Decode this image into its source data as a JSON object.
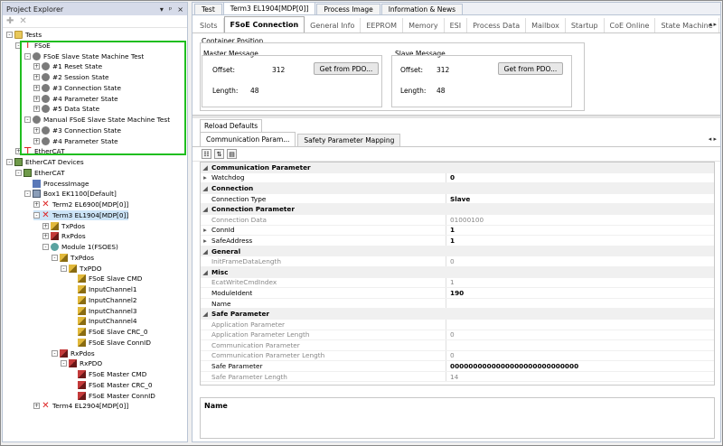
{
  "left": {
    "title": "Project Explorer",
    "title_btns": [
      "▾",
      "ᵖ",
      "×"
    ],
    "toolbar": [
      "✚",
      "✕"
    ]
  },
  "tree": [
    {
      "t": "Tests",
      "d": 0,
      "ic": "folder",
      "ex": "-"
    },
    {
      "t": "FSoE",
      "d": 1,
      "ic": "fsoe",
      "ex": "-"
    },
    {
      "t": "FSoE Slave State Machine Test",
      "d": 2,
      "ic": "ball",
      "ex": "-"
    },
    {
      "t": "#1 Reset State",
      "d": 3,
      "ic": "ball",
      "ex": "+"
    },
    {
      "t": "#2 Session State",
      "d": 3,
      "ic": "ball",
      "ex": "+"
    },
    {
      "t": "#3 Connection State",
      "d": 3,
      "ic": "ball",
      "ex": "+"
    },
    {
      "t": "#4 Parameter State",
      "d": 3,
      "ic": "ball",
      "ex": "+"
    },
    {
      "t": "#5 Data State",
      "d": 3,
      "ic": "ball",
      "ex": "+"
    },
    {
      "t": "Manual FSoE Slave State Machine Test",
      "d": 2,
      "ic": "ball",
      "ex": "-"
    },
    {
      "t": "#3 Connection State",
      "d": 3,
      "ic": "ball",
      "ex": "+"
    },
    {
      "t": "#4 Parameter State",
      "d": 3,
      "ic": "ball",
      "ex": "+"
    },
    {
      "t": "EtherCAT",
      "d": 1,
      "ic": "fsoe",
      "ex": "+"
    },
    {
      "t": "EtherCAT Devices",
      "d": 0,
      "ic": "eth",
      "ex": "-"
    },
    {
      "t": "EtherCAT",
      "d": 1,
      "ic": "eth",
      "ex": "-"
    },
    {
      "t": "ProcessImage",
      "d": 2,
      "ic": "pi",
      "ex": ""
    },
    {
      "t": "Box1 EK1100[Default]",
      "d": 2,
      "ic": "box",
      "ex": "-"
    },
    {
      "t": "Term2 EL6900[MDP[0]]",
      "d": 3,
      "ic": "x",
      "ex": "+"
    },
    {
      "t": "Term3 EL1904[MDP[0]]",
      "d": 3,
      "ic": "x",
      "ex": "-",
      "sel": true
    },
    {
      "t": "TxPdos",
      "d": 4,
      "ic": "io-y",
      "ex": "+"
    },
    {
      "t": "RxPdos",
      "d": 4,
      "ic": "io-r",
      "ex": "+"
    },
    {
      "t": "Module 1(FSOES)",
      "d": 4,
      "ic": "gear",
      "ex": "-"
    },
    {
      "t": "TxPdos",
      "d": 5,
      "ic": "io-y",
      "ex": "-"
    },
    {
      "t": "TxPDO",
      "d": 6,
      "ic": "io-y",
      "ex": "-"
    },
    {
      "t": "FSoE Slave CMD",
      "d": 7,
      "ic": "io-y",
      "ex": ""
    },
    {
      "t": "InputChannel1",
      "d": 7,
      "ic": "io-y",
      "ex": ""
    },
    {
      "t": "InputChannel2",
      "d": 7,
      "ic": "io-y",
      "ex": ""
    },
    {
      "t": "InputChannel3",
      "d": 7,
      "ic": "io-y",
      "ex": ""
    },
    {
      "t": "InputChannel4",
      "d": 7,
      "ic": "io-y",
      "ex": ""
    },
    {
      "t": "FSoE Slave CRC_0",
      "d": 7,
      "ic": "io-y",
      "ex": ""
    },
    {
      "t": "FSoE Slave ConnID",
      "d": 7,
      "ic": "io-y",
      "ex": ""
    },
    {
      "t": "RxPdos",
      "d": 5,
      "ic": "io-r",
      "ex": "-"
    },
    {
      "t": "RxPDO",
      "d": 6,
      "ic": "io-r",
      "ex": "-"
    },
    {
      "t": "FSoE Master CMD",
      "d": 7,
      "ic": "io-r",
      "ex": ""
    },
    {
      "t": "FSoE Master CRC_0",
      "d": 7,
      "ic": "io-r",
      "ex": ""
    },
    {
      "t": "FSoE Master ConnID",
      "d": 7,
      "ic": "io-r",
      "ex": ""
    },
    {
      "t": "Term4 EL2904[MDP[0]]",
      "d": 3,
      "ic": "x",
      "ex": "+"
    }
  ],
  "doc_tabs": [
    {
      "label": "Test",
      "active": false
    },
    {
      "label": "Term3 EL1904[MDP[0]]",
      "active": true
    },
    {
      "label": "Process Image",
      "active": false
    },
    {
      "label": "Information & News",
      "active": false
    }
  ],
  "sub_tabs": [
    {
      "label": "Slots",
      "active": false
    },
    {
      "label": "FSoE Connection",
      "active": true
    },
    {
      "label": "General Info",
      "active": false
    },
    {
      "label": "EEPROM",
      "active": false
    },
    {
      "label": "Memory",
      "active": false
    },
    {
      "label": "ESI",
      "active": false
    },
    {
      "label": "Process Data",
      "active": false
    },
    {
      "label": "Mailbox",
      "active": false
    },
    {
      "label": "Startup",
      "active": false
    },
    {
      "label": "CoE Online",
      "active": false
    },
    {
      "label": "State Machine",
      "active": false
    }
  ],
  "container": {
    "title": "Container Position",
    "master": {
      "title": "Master Message",
      "offset_label": "Offset:",
      "offset": "312",
      "length_label": "Length:",
      "length": "48",
      "btn": "Get from PDO..."
    },
    "slave": {
      "title": "Slave Message",
      "offset_label": "Offset:",
      "offset": "312",
      "length_label": "Length:",
      "length": "48",
      "btn": "Get from PDO..."
    }
  },
  "reload": "Reload Defaults",
  "param_tabs": [
    {
      "label": "Communication Param...",
      "active": true
    },
    {
      "label": "Safety Parameter Mapping",
      "active": false
    }
  ],
  "grid": [
    {
      "n": "Communication Parameter",
      "cat": true
    },
    {
      "n": "Watchdog",
      "v": "0",
      "b": true,
      "g": "▸"
    },
    {
      "n": "Connection",
      "cat": true
    },
    {
      "n": "Connection Type",
      "v": "Slave",
      "b": true
    },
    {
      "n": "Connection Parameter",
      "cat": true
    },
    {
      "n": "Connection Data",
      "v": "01000100",
      "dis": true
    },
    {
      "n": "ConnId",
      "v": "1",
      "b": true,
      "g": "▸"
    },
    {
      "n": "SafeAddress",
      "v": "1",
      "b": true,
      "g": "▸"
    },
    {
      "n": "General",
      "cat": true
    },
    {
      "n": "InitFrameDataLength",
      "v": "0",
      "dis": true
    },
    {
      "n": "Misc",
      "cat": true
    },
    {
      "n": "EcatWriteCmdIndex",
      "v": "1",
      "dis": true
    },
    {
      "n": "ModuleIdent",
      "v": "190",
      "b": true
    },
    {
      "n": "Name",
      "v": ""
    },
    {
      "n": "Safe Parameter",
      "cat": true
    },
    {
      "n": "Application Parameter",
      "v": "",
      "dis": true
    },
    {
      "n": "Application Parameter Length",
      "v": "0",
      "dis": true
    },
    {
      "n": "Communication Parameter",
      "v": "",
      "dis": true
    },
    {
      "n": "Communication Parameter Length",
      "v": "0",
      "dis": true
    },
    {
      "n": "Safe Parameter",
      "v": "0000000000000000000000000000",
      "b": true
    },
    {
      "n": "Safe Parameter Length",
      "v": "14",
      "dis": true
    }
  ],
  "desc_title": "Name"
}
